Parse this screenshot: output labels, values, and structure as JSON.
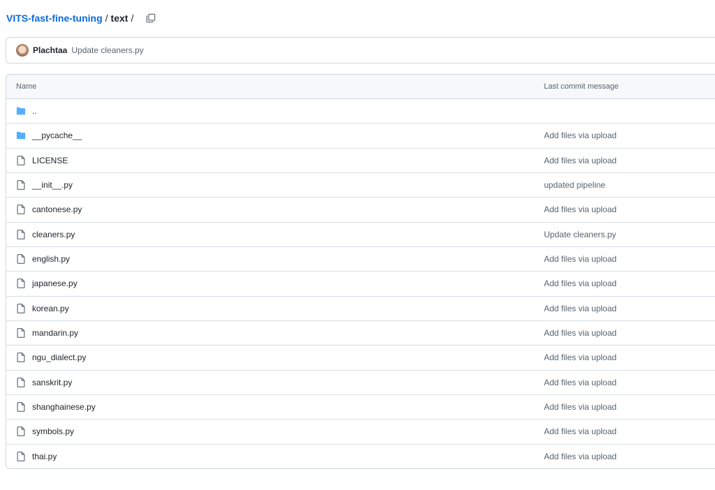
{
  "breadcrumb": {
    "repo": "VITS-fast-fine-tuning",
    "separator1": "/",
    "current": "text",
    "separator2": "/"
  },
  "commit_bar": {
    "author": "Plachtaa",
    "message": "Update cleaners.py"
  },
  "table": {
    "headers": {
      "name": "Name",
      "last_commit": "Last commit message"
    },
    "rows": [
      {
        "type": "folder",
        "name": "..",
        "commit": ""
      },
      {
        "type": "folder",
        "name": "__pycache__",
        "commit": "Add files via upload"
      },
      {
        "type": "file",
        "name": "LICENSE",
        "commit": "Add files via upload"
      },
      {
        "type": "file",
        "name": "__init__.py",
        "commit": "updated pipeline"
      },
      {
        "type": "file",
        "name": "cantonese.py",
        "commit": "Add files via upload"
      },
      {
        "type": "file",
        "name": "cleaners.py",
        "commit": "Update cleaners.py"
      },
      {
        "type": "file",
        "name": "english.py",
        "commit": "Add files via upload"
      },
      {
        "type": "file",
        "name": "japanese.py",
        "commit": "Add files via upload"
      },
      {
        "type": "file",
        "name": "korean.py",
        "commit": "Add files via upload"
      },
      {
        "type": "file",
        "name": "mandarin.py",
        "commit": "Add files via upload"
      },
      {
        "type": "file",
        "name": "ngu_dialect.py",
        "commit": "Add files via upload"
      },
      {
        "type": "file",
        "name": "sanskrit.py",
        "commit": "Add files via upload"
      },
      {
        "type": "file",
        "name": "shanghainese.py",
        "commit": "Add files via upload"
      },
      {
        "type": "file",
        "name": "symbols.py",
        "commit": "Add files via upload"
      },
      {
        "type": "file",
        "name": "thai.py",
        "commit": "Add files via upload"
      }
    ]
  },
  "icons": {
    "folder": "folder-icon",
    "file": "file-icon",
    "copy": "copy-icon"
  },
  "colors": {
    "link": "#0969da",
    "folder": "#54aeff",
    "muted": "#59636e",
    "border": "#d0d7de"
  }
}
